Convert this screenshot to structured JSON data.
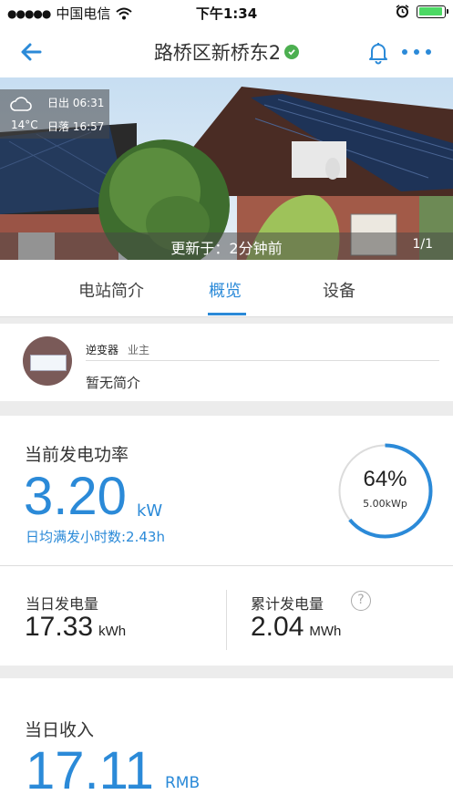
{
  "status_bar": {
    "signal": "●●●●●",
    "carrier": "中国电信",
    "wifi_icon": "wifi-icon",
    "time": "下午1:34",
    "alarm_icon": "alarm-clock-icon",
    "battery_level": 0.95
  },
  "nav": {
    "title": "路桥区新桥东2",
    "verified_icon": "verified-check-icon",
    "back_icon": "arrow-left-icon",
    "bell_icon": "bell-icon",
    "more_icon": "more-dots-icon"
  },
  "hero": {
    "weather_icon": "cloud-icon",
    "sunrise": "日出 06:31",
    "temperature": "14°C",
    "sunset": "日落 16:57",
    "updated": "更新于：2分钟前",
    "page_indicator": "1/1"
  },
  "tabs": [
    {
      "label": "电站简介",
      "active": false
    },
    {
      "label": "概览",
      "active": true
    },
    {
      "label": "设备",
      "active": false
    }
  ],
  "intro": {
    "device": "逆变器",
    "role": "业主",
    "description": "暂无简介"
  },
  "power": {
    "label": "当前发电功率",
    "value": "3.20",
    "unit": "kW",
    "hours": "日均满发小时数:2.43h",
    "gauge_percent": "64%",
    "gauge_fraction": 0.64,
    "capacity": "5.00kWp"
  },
  "energy": {
    "daily_label": "当日发电量",
    "daily_value": "17.33",
    "daily_unit": "kWh",
    "total_label": "累计发电量",
    "total_value": "2.04",
    "total_unit": "MWh",
    "help_icon": "question-circle-icon",
    "help_symbol": "?"
  },
  "income": {
    "label": "当日收入",
    "value": "17.11",
    "unit": "RMB"
  },
  "colors": {
    "accent": "#2b8ad8",
    "verified": "#4caf50",
    "battery": "#4cd964"
  }
}
